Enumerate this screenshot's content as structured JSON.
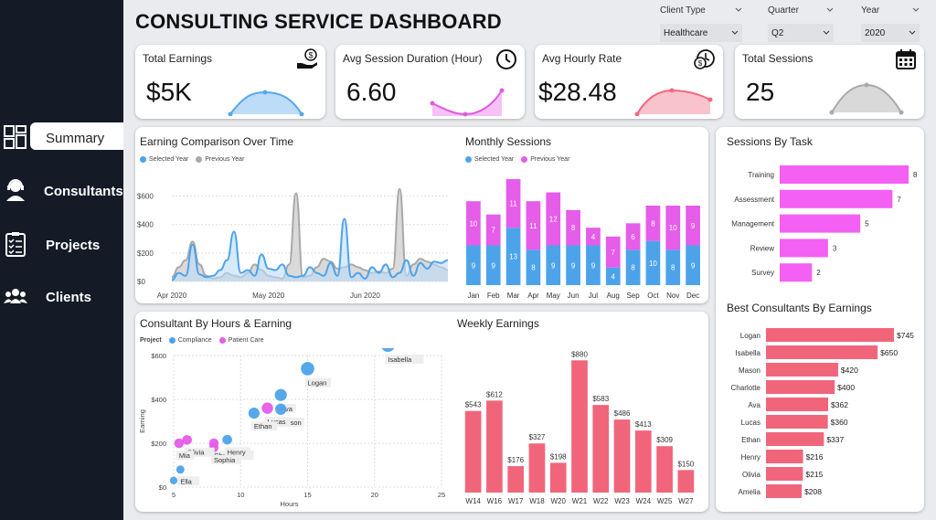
{
  "sidebar": {
    "items": [
      {
        "label": "Summary",
        "icon": "dashboard-icon"
      },
      {
        "label": "Consultants",
        "icon": "consultant-icon"
      },
      {
        "label": "Projects",
        "icon": "clipboard-icon"
      },
      {
        "label": "Clients",
        "icon": "group-icon"
      }
    ]
  },
  "header": {
    "title": "CONSULTING SERVICE DASHBOARD"
  },
  "filters": [
    {
      "label": "Client Type",
      "value": "Healthcare"
    },
    {
      "label": "Quarter",
      "value": "Q2"
    },
    {
      "label": "Year",
      "value": "2020"
    }
  ],
  "kpis": [
    {
      "title": "Total Earnings",
      "value": "$5K",
      "icon": "dollar-hand-icon",
      "color": "#56a7ea"
    },
    {
      "title": "Avg Session Duration (Hour)",
      "value": "6.60",
      "icon": "clock-icon",
      "color": "#e05ae0"
    },
    {
      "title": "Avg Hourly Rate",
      "value": "$28.48",
      "icon": "coins-clock-icon",
      "color": "#f3677e"
    },
    {
      "title": "Total Sessions",
      "value": "25",
      "icon": "calendar-icon",
      "color": "#a9a9a9"
    }
  ],
  "colors": {
    "blue": "#4da3ea",
    "pink": "#e55de9",
    "gray": "#a9a9a9",
    "red": "#f1657b",
    "magenta": "#f45ff4",
    "sidebar": "#141b26"
  },
  "earning_comparison": {
    "title": "Earning Comparison Over Time",
    "legend": [
      "Selected Year",
      "Previous Year"
    ],
    "chart_data": {
      "type": "area",
      "y_ticks": [
        "$0",
        "$200",
        "$400",
        "$600"
      ],
      "x_ticks": [
        "Apr 2020",
        "May 2020",
        "Jun 2020"
      ],
      "ylim": [
        0,
        700
      ],
      "series": [
        {
          "name": "Selected Year",
          "values": [
            10,
            60,
            40,
            260,
            50,
            30,
            40,
            80,
            150,
            350,
            60,
            80,
            40,
            190,
            90,
            80,
            120,
            40,
            30,
            40,
            100,
            60,
            40,
            130,
            40,
            440,
            30,
            60,
            20,
            100,
            60,
            120,
            30,
            60,
            150,
            40,
            130,
            90,
            140,
            130,
            150
          ]
        },
        {
          "name": "Previous Year",
          "values": [
            30,
            100,
            150,
            280,
            120,
            40,
            20,
            30,
            60,
            40,
            30,
            60,
            120,
            80,
            40,
            30,
            20,
            120,
            620,
            30,
            40,
            100,
            160,
            140,
            90,
            100,
            120,
            100,
            80,
            60,
            70,
            60,
            90,
            650,
            40,
            120,
            160,
            140,
            120,
            100,
            80
          ]
        }
      ]
    }
  },
  "monthly_sessions": {
    "title": "Monthly Sessions",
    "legend": [
      "Selected Year",
      "Previous Year"
    ],
    "chart_data": {
      "type": "bar",
      "categories": [
        "Jan",
        "Feb",
        "Mar",
        "Apr",
        "May",
        "Jun",
        "Jul",
        "Aug",
        "Sep",
        "Oct",
        "Nov",
        "Dec"
      ],
      "series": [
        {
          "name": "Selected Year",
          "values": [
            9,
            9,
            13,
            8,
            9,
            9,
            9,
            4,
            8,
            10,
            8,
            9
          ]
        },
        {
          "name": "Previous Year",
          "values": [
            10,
            7,
            11,
            11,
            12,
            8,
            4,
            7,
            6,
            8,
            10,
            9
          ]
        }
      ]
    }
  },
  "sessions_by_task": {
    "title": "Sessions By Task",
    "chart_data": {
      "type": "bar",
      "categories": [
        "Training",
        "Assessment",
        "Management",
        "Review",
        "Survey"
      ],
      "values": [
        8,
        7,
        5,
        3,
        2
      ],
      "xlim": [
        0,
        8
      ]
    }
  },
  "consultant_hours": {
    "title": "Consultant By Hours & Earning",
    "legend_title": "Project",
    "legend": [
      "Compliance",
      "Patient Care"
    ],
    "chart_data": {
      "type": "scatter",
      "xlabel": "Hours",
      "ylabel": "Earning",
      "x_ticks": [
        "5",
        "10",
        "15",
        "20",
        "25"
      ],
      "y_ticks": [
        "$0",
        "$200",
        "$400",
        "$600"
      ],
      "xlim": [
        5,
        25
      ],
      "ylim": [
        0,
        600
      ],
      "points": [
        {
          "name": "Isabella",
          "x": 21,
          "y": 650,
          "project": "Compliance"
        },
        {
          "name": "Logan",
          "x": 15,
          "y": 540,
          "project": "Compliance"
        },
        {
          "name": "Ava",
          "x": 13,
          "y": 420,
          "project": "Compliance"
        },
        {
          "name": "Mason",
          "x": 13,
          "y": 355,
          "project": "Compliance"
        },
        {
          "name": "Lucas",
          "x": 12,
          "y": 360,
          "project": "Patient Care"
        },
        {
          "name": "Ethan",
          "x": 11,
          "y": 337,
          "project": "Compliance"
        },
        {
          "name": "Charlotte",
          "x": 8,
          "y": 200,
          "project": "Patient Care"
        },
        {
          "name": "Henry",
          "x": 9,
          "y": 216,
          "project": "Compliance"
        },
        {
          "name": "Sophia",
          "x": 8,
          "y": 180,
          "project": "Patient Care"
        },
        {
          "name": "Olivia",
          "x": 6,
          "y": 215,
          "project": "Patient Care"
        },
        {
          "name": "Mia",
          "x": 5.4,
          "y": 200,
          "project": "Patient Care"
        },
        {
          "name": "Ella",
          "x": 5.5,
          "y": 80,
          "project": "Compliance"
        },
        {
          "name": "",
          "x": 5,
          "y": 30,
          "project": "Compliance"
        }
      ]
    }
  },
  "weekly_earnings": {
    "title": "Weekly Earnings",
    "chart_data": {
      "type": "bar",
      "categories": [
        "W14",
        "W16",
        "W17",
        "W18",
        "W20",
        "W21",
        "W22",
        "W23",
        "W24",
        "W25",
        "W27"
      ],
      "values": [
        543,
        612,
        176,
        327,
        198,
        880,
        583,
        486,
        413,
        309,
        150
      ],
      "labels": [
        "$543",
        "$612",
        "$176",
        "$327",
        "$198",
        "$880",
        "$583",
        "$486",
        "$413",
        "$309",
        "$150"
      ],
      "ylim": [
        0,
        900
      ]
    }
  },
  "best_consultants": {
    "title": "Best Consultants By Earnings",
    "chart_data": {
      "type": "bar",
      "categories": [
        "Logan",
        "Isabella",
        "Mason",
        "Charlotte",
        "Ava",
        "Lucas",
        "Ethan",
        "Henry",
        "Olivia",
        "Amelia"
      ],
      "values": [
        745,
        650,
        420,
        400,
        362,
        360,
        337,
        216,
        215,
        208
      ],
      "labels": [
        "$745",
        "$650",
        "$420",
        "$400",
        "$362",
        "$360",
        "$337",
        "$216",
        "$215",
        "$208"
      ],
      "xlim": [
        0,
        745
      ]
    }
  }
}
